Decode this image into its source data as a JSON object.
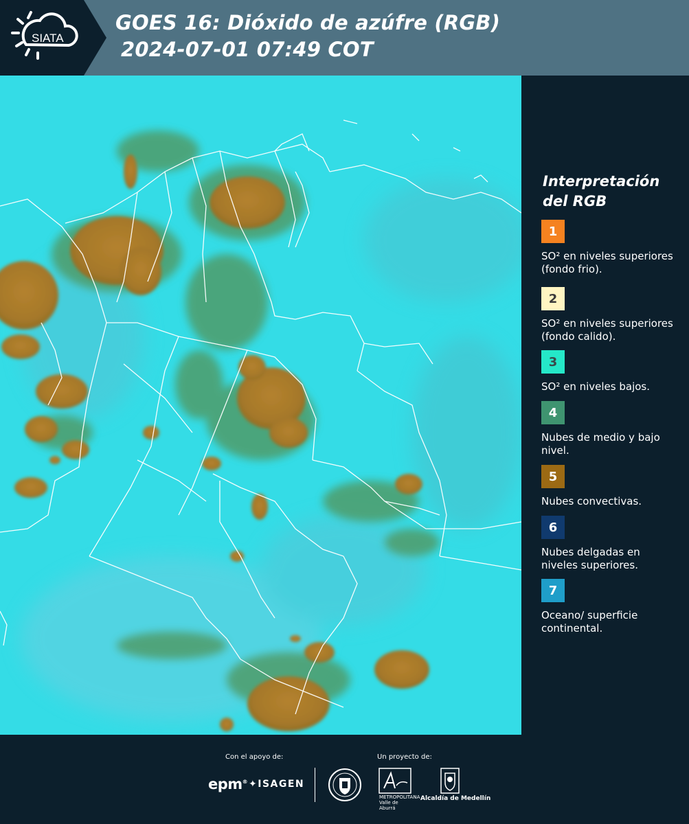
{
  "header": {
    "logo_text": "SIATA",
    "title_line1": "GOES 16: Dióxido de azúfre (RGB)",
    "title_line2": "2024-07-01 07:49 COT",
    "bg_color": "#4f7283"
  },
  "legend": {
    "title_line1": "Interpretación",
    "title_line2": "del RGB",
    "items": [
      {
        "number": "1",
        "color": "#f58220",
        "text_color": "#ffffff",
        "label": "SO² en niveles superiores (fondo frio)."
      },
      {
        "number": "2",
        "color": "#fff5c2",
        "text_color": "#3a3a3a",
        "label": "SO² en niveles superiores (fondo calido)."
      },
      {
        "number": "3",
        "color": "#25e8c8",
        "text_color": "#3a4a4a",
        "label": "SO² en niveles bajos."
      },
      {
        "number": "4",
        "color": "#3f9470",
        "text_color": "#ffffff",
        "label": "Nubes de medio y bajo nivel."
      },
      {
        "number": "5",
        "color": "#9c6a14",
        "text_color": "#ffffff",
        "label": "Nubes convectivas."
      },
      {
        "number": "6",
        "color": "#103a6e",
        "text_color": "#ffffff",
        "label": "Nubes delgadas en niveles superiores."
      },
      {
        "number": "7",
        "color": "#1f9ec9",
        "text_color": "#ffffff",
        "label": "Oceano/ superficie continental."
      }
    ]
  },
  "footer": {
    "support_label": "Con el apoyo de:",
    "project_label": "Un proyecto de:",
    "epm_logo": "epm",
    "isagen_logo": "ISAGEN",
    "area_logo_text": "METROPOLITANA Valle de Aburrá",
    "alcaldia_logo_text": "Alcaldía de Medellín"
  },
  "colors": {
    "background": "#0c1f2c",
    "map_surface": "#2fd9e3",
    "convective": "#a7792a",
    "midlevel": "#4f9c6a",
    "border_lines": "#ffffff"
  }
}
